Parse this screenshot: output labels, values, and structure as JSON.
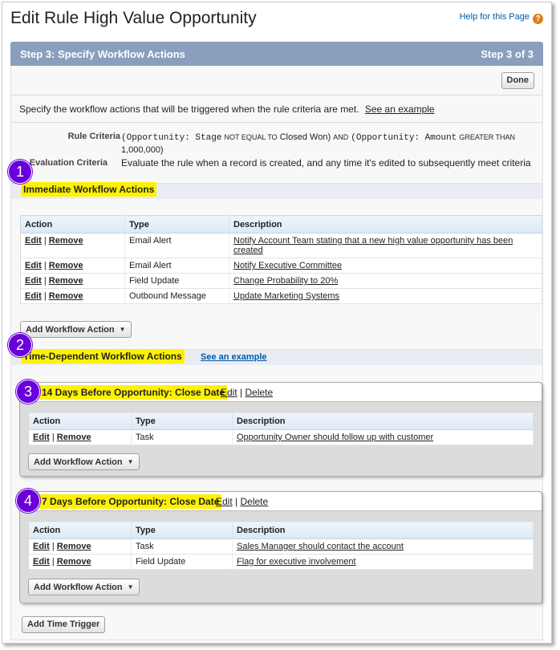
{
  "page": {
    "title": "Edit Rule High Value Opportunity",
    "help_label": "Help for this Page",
    "help_icon": "?"
  },
  "step": {
    "title": "Step 3: Specify Workflow Actions",
    "progress": "Step 3 of 3",
    "done_label": "Done",
    "instruction": "Specify the workflow actions that will be triggered when the rule criteria are met.",
    "see_example": "See an example"
  },
  "criteria": {
    "rule_label": "Rule Criteria",
    "rule_part1": "(Opportunity: Stage",
    "rule_op1": "not equal to",
    "rule_val1": "Closed Won)",
    "rule_and": "and",
    "rule_part2": "(Opportunity: Amount",
    "rule_op2": "greater than",
    "rule_val2": "1,000,000)",
    "eval_label": "Evaluation Criteria",
    "eval_value": "Evaluate the rule when a record is created, and any time it's edited to subsequently meet criteria"
  },
  "badges": [
    "1",
    "2",
    "3",
    "4"
  ],
  "immediate": {
    "title": "Immediate Workflow Actions",
    "columns": [
      "Action",
      "Type",
      "Description"
    ],
    "rows": [
      {
        "edit": "Edit",
        "remove": "Remove",
        "type": "Email Alert",
        "desc": "Notify Account Team stating that a new high value opportunity has been created"
      },
      {
        "edit": "Edit",
        "remove": "Remove",
        "type": "Email Alert",
        "desc": "Notify Executive Committee"
      },
      {
        "edit": "Edit",
        "remove": "Remove",
        "type": "Field Update",
        "desc": "Change Probability to 20%"
      },
      {
        "edit": "Edit",
        "remove": "Remove",
        "type": "Outbound Message",
        "desc": "Update Marketing Systems"
      }
    ],
    "add_label": "Add Workflow Action"
  },
  "time_dependent": {
    "title": "Time-Dependent Workflow Actions",
    "see_example": "See an example",
    "triggers": [
      {
        "title": "14 Days Before Opportunity: Close Date",
        "edit": "Edit",
        "delete": "Delete",
        "columns": [
          "Action",
          "Type",
          "Description"
        ],
        "rows": [
          {
            "edit": "Edit",
            "remove": "Remove",
            "type": "Task",
            "desc": "Opportunity Owner should follow up with customer"
          }
        ],
        "add_label": "Add Workflow Action"
      },
      {
        "title": "7 Days Before Opportunity: Close Date",
        "edit": "Edit",
        "delete": "Delete",
        "columns": [
          "Action",
          "Type",
          "Description"
        ],
        "rows": [
          {
            "edit": "Edit",
            "remove": "Remove",
            "type": "Task",
            "desc": "Sales Manager should contact the account"
          },
          {
            "edit": "Edit",
            "remove": "Remove",
            "type": "Field Update",
            "desc": "Flag for executive involvement"
          }
        ],
        "add_label": "Add Workflow Action"
      }
    ],
    "add_trigger_label": "Add Time Trigger"
  },
  "colors": {
    "step_bar": "#8a9ebe",
    "highlight": "#fff200",
    "badge": "#6a00d9",
    "help_link": "#015ba7"
  }
}
